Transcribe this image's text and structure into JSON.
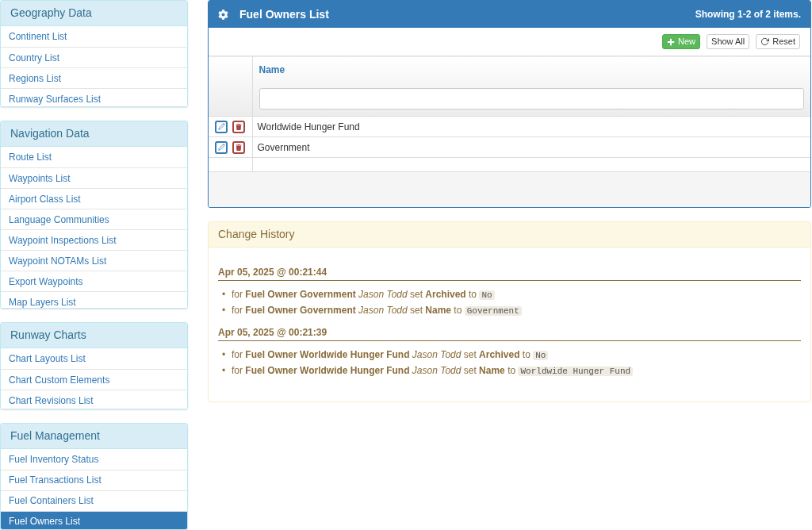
{
  "sidebar": [
    {
      "title": "Geography Data",
      "items": [
        {
          "label": "Continent List",
          "selected": false
        },
        {
          "label": "Country List",
          "selected": false
        },
        {
          "label": "Regions List",
          "selected": false
        },
        {
          "label": "Runway Surfaces List",
          "selected": false
        }
      ]
    },
    {
      "title": "Navigation Data",
      "items": [
        {
          "label": "Route List",
          "selected": false
        },
        {
          "label": "Waypoints List",
          "selected": false
        },
        {
          "label": "Airport Class List",
          "selected": false
        },
        {
          "label": "Language Communities",
          "selected": false
        },
        {
          "label": "Waypoint Inspections List",
          "selected": false
        },
        {
          "label": "Waypoint NOTAMs List",
          "selected": false
        },
        {
          "label": "Export Waypoints",
          "selected": false
        },
        {
          "label": "Map Layers List",
          "selected": false
        }
      ]
    },
    {
      "title": "Runway Charts",
      "items": [
        {
          "label": "Chart Layouts List",
          "selected": false
        },
        {
          "label": "Chart Custom Elements",
          "selected": false
        },
        {
          "label": "Chart Revisions List",
          "selected": false
        }
      ]
    },
    {
      "title": "Fuel Management",
      "items": [
        {
          "label": "Fuel Inventory Status",
          "selected": false
        },
        {
          "label": "Fuel Transactions List",
          "selected": false
        },
        {
          "label": "Fuel Containers List",
          "selected": false
        },
        {
          "label": "Fuel Owners List",
          "selected": true
        }
      ]
    }
  ],
  "panel": {
    "title": "Fuel Owners List",
    "summary": "Showing 1-2 of 2 items.",
    "buttons": [
      {
        "kind": "new",
        "label": "New"
      },
      {
        "kind": "show_all",
        "label": "Show All"
      },
      {
        "kind": "reset",
        "label": "Reset"
      }
    ],
    "table": {
      "columns": [
        "Name"
      ],
      "rows": [
        [
          "Worldwide Hunger Fund"
        ],
        [
          "Government"
        ]
      ]
    }
  },
  "history": {
    "title": "Change History",
    "groups": [
      {
        "timestamp": "Apr 05, 2025 @ 00:21:44",
        "entries": [
          {
            "bullet": "•",
            "text": "for **Fuel Owner Government** *Jason Todd* set **Archived** to",
            "value": "No"
          },
          {
            "bullet": "•",
            "text": "for **Fuel Owner Government** *Jason Todd* set **Name** to",
            "value": "Government"
          }
        ]
      },
      {
        "timestamp": "Apr 05, 2025 @ 00:21:39",
        "entries": [
          {
            "bullet": "•",
            "text": "for **Fuel Owner Worldwide Hunger Fund** *Jason Todd* set **Archived** to",
            "value": "No"
          },
          {
            "bullet": "•",
            "text": "for **Fuel Owner Worldwide Hunger Fund** *Jason Todd* set **Name** to",
            "value": "Worldwide Hunger Fund"
          }
        ]
      }
    ]
  }
}
